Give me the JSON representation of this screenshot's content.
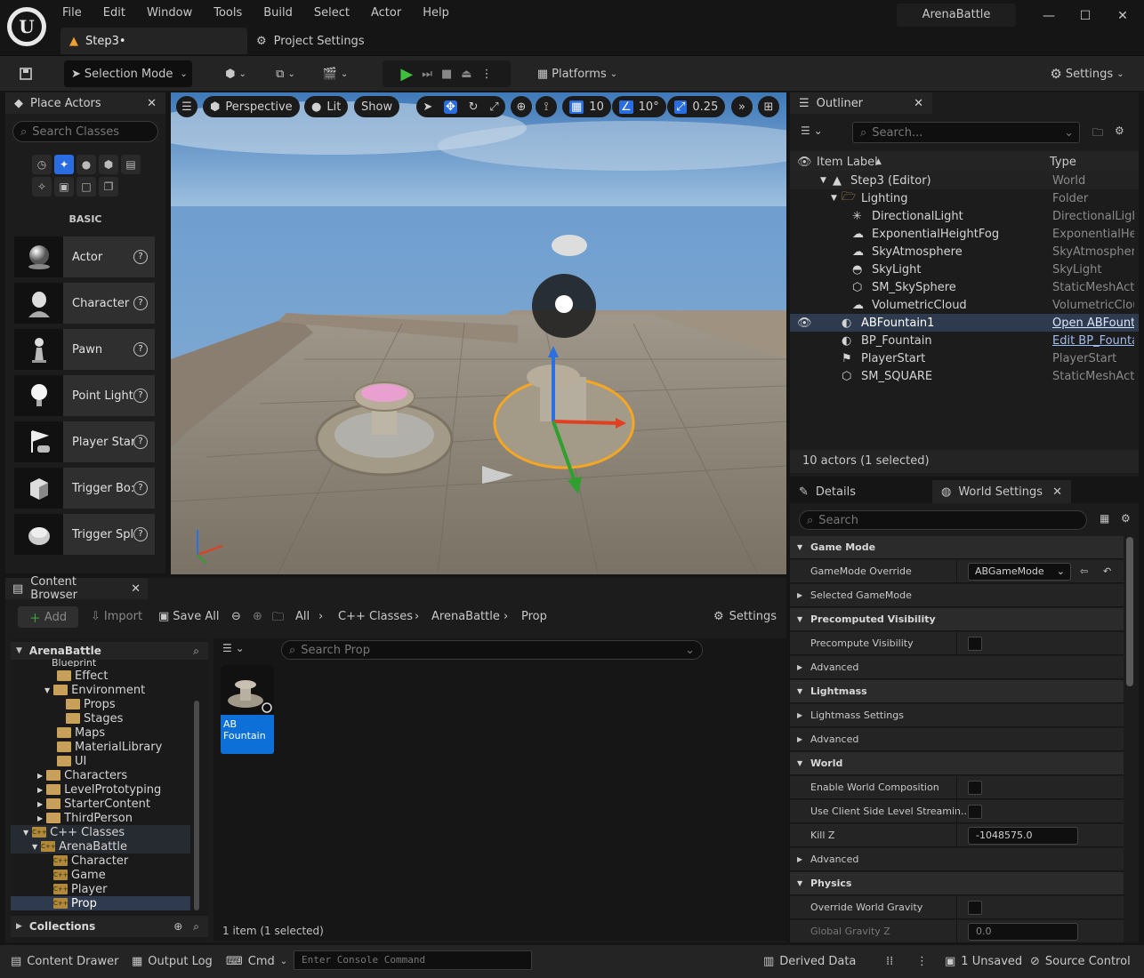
{
  "window": {
    "project_name": "ArenaBattle",
    "menu": [
      "File",
      "Edit",
      "Window",
      "Tools",
      "Build",
      "Select",
      "Actor",
      "Help"
    ],
    "tabs": [
      {
        "label": "Step3•"
      },
      {
        "label": "Project Settings"
      }
    ]
  },
  "toolbar": {
    "selection_mode": "Selection Mode",
    "platforms": "Platforms",
    "settings": "Settings"
  },
  "place_actors": {
    "title": "Place Actors",
    "search_placeholder": "Search Classes",
    "category": "BASIC",
    "items": [
      "Actor",
      "Character",
      "Pawn",
      "Point Light",
      "Player Star",
      "Trigger Bo:",
      "Trigger Spl"
    ]
  },
  "viewport": {
    "perspective": "Perspective",
    "lit": "Lit",
    "show": "Show",
    "grid_snap": "10",
    "rotation_snap": "10°",
    "scale_snap": "0.25"
  },
  "outliner": {
    "title": "Outliner",
    "search_placeholder": "Search...",
    "col_label": "Item Label",
    "col_type": "Type",
    "rows": [
      {
        "label": "Step3 (Editor)",
        "type": "World"
      },
      {
        "label": "Lighting",
        "type": "Folder"
      },
      {
        "label": "DirectionalLight",
        "type": "DirectionalLight"
      },
      {
        "label": "ExponentialHeightFog",
        "type": "ExponentialHeigh"
      },
      {
        "label": "SkyAtmosphere",
        "type": "SkyAtmosphere"
      },
      {
        "label": "SkyLight",
        "type": "SkyLight"
      },
      {
        "label": "SM_SkySphere",
        "type": "StaticMeshActor"
      },
      {
        "label": "VolumetricCloud",
        "type": "VolumetricCloud"
      },
      {
        "label": "ABFountain1",
        "type": "Open ABFountain"
      },
      {
        "label": "BP_Fountain",
        "type": "Edit BP_Fountain"
      },
      {
        "label": "PlayerStart",
        "type": "PlayerStart"
      },
      {
        "label": "SM_SQUARE",
        "type": "StaticMeshActor"
      }
    ],
    "count": "10 actors (1 selected)"
  },
  "details": {
    "tab_details": "Details",
    "tab_world": "World Settings",
    "search_placeholder": "Search",
    "rows": [
      {
        "label": "Game Mode"
      },
      {
        "label": "GameMode Override",
        "value": "ABGameMode"
      },
      {
        "label": "Selected GameMode"
      },
      {
        "label": "Precomputed Visibility"
      },
      {
        "label": "Precompute Visibility"
      },
      {
        "label": "Advanced"
      },
      {
        "label": "Lightmass"
      },
      {
        "label": "Lightmass Settings"
      },
      {
        "label": "Advanced"
      },
      {
        "label": "World"
      },
      {
        "label": "Enable World Composition"
      },
      {
        "label": "Use Client Side Level Streamin..."
      },
      {
        "label": "Kill Z",
        "value": "-1048575.0"
      },
      {
        "label": "Advanced"
      },
      {
        "label": "Physics"
      },
      {
        "label": "Override World Gravity"
      },
      {
        "label": "Global Gravity Z",
        "value": "0.0"
      }
    ]
  },
  "content_browser": {
    "title": "Content Browser",
    "add": "Add",
    "import": "Import",
    "save_all": "Save All",
    "breadcrumb": [
      "All",
      "C++ Classes",
      "ArenaBattle",
      "Prop"
    ],
    "settings": "Settings",
    "root": "ArenaBattle",
    "tree": [
      "Blueprint",
      "Effect",
      "Environment",
      "Props",
      "Stages",
      "Maps",
      "MaterialLibrary",
      "UI",
      "Characters",
      "LevelPrototyping",
      "StarterContent",
      "ThirdPerson",
      "C++ Classes",
      "ArenaBattle",
      "Character",
      "Game",
      "Player",
      "Prop"
    ],
    "collections": "Collections",
    "search_placeholder": "Search Prop",
    "asset_name": "AB Fountain",
    "count": "1 item (1 selected)"
  },
  "status": {
    "content_drawer": "Content Drawer",
    "output_log": "Output Log",
    "cmd": "Cmd",
    "console_placeholder": "Enter Console Command",
    "derived_data": "Derived Data",
    "unsaved": "1 Unsaved",
    "source_control": "Source Control"
  },
  "colors": {
    "accent": "#0d70d8",
    "play": "#3fc03f",
    "selection": "#2e3a4e"
  }
}
